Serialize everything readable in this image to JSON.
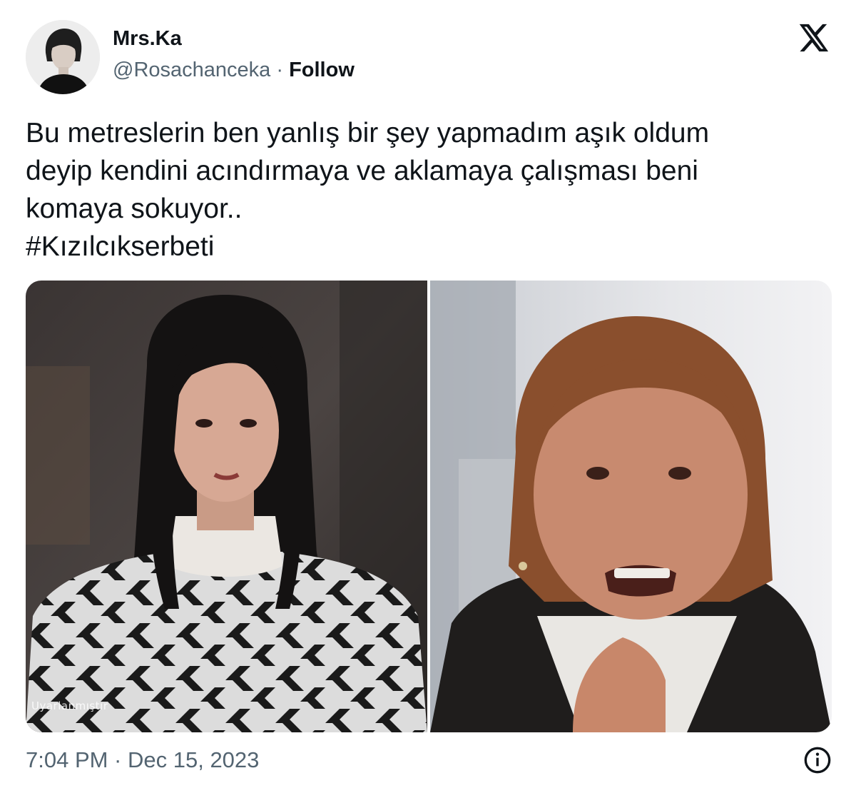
{
  "author": {
    "display_name": "Mrs.Ka",
    "handle": "@Rosachanceka",
    "separator": " · ",
    "follow_label": "Follow"
  },
  "tweet": {
    "text_lines": [
      "Bu metreslerin ben yanlış bir şey yapmadım aşık oldum",
      "deyip kendini acındırmaya ve aklamaya çalışması beni",
      "komaya sokuyor..",
      "#Kızılcıkserbeti"
    ],
    "hashtag_color": "#0f1419"
  },
  "media": {
    "left_watermark": "Uyarlanmıştır"
  },
  "footer": {
    "timestamp": "7:04 PM · Dec 15, 2023"
  },
  "icons": {
    "brand": "x-logo-icon",
    "info": "info-icon"
  },
  "colors": {
    "text_primary": "#0f1419",
    "text_secondary": "#536471",
    "background": "#ffffff"
  }
}
